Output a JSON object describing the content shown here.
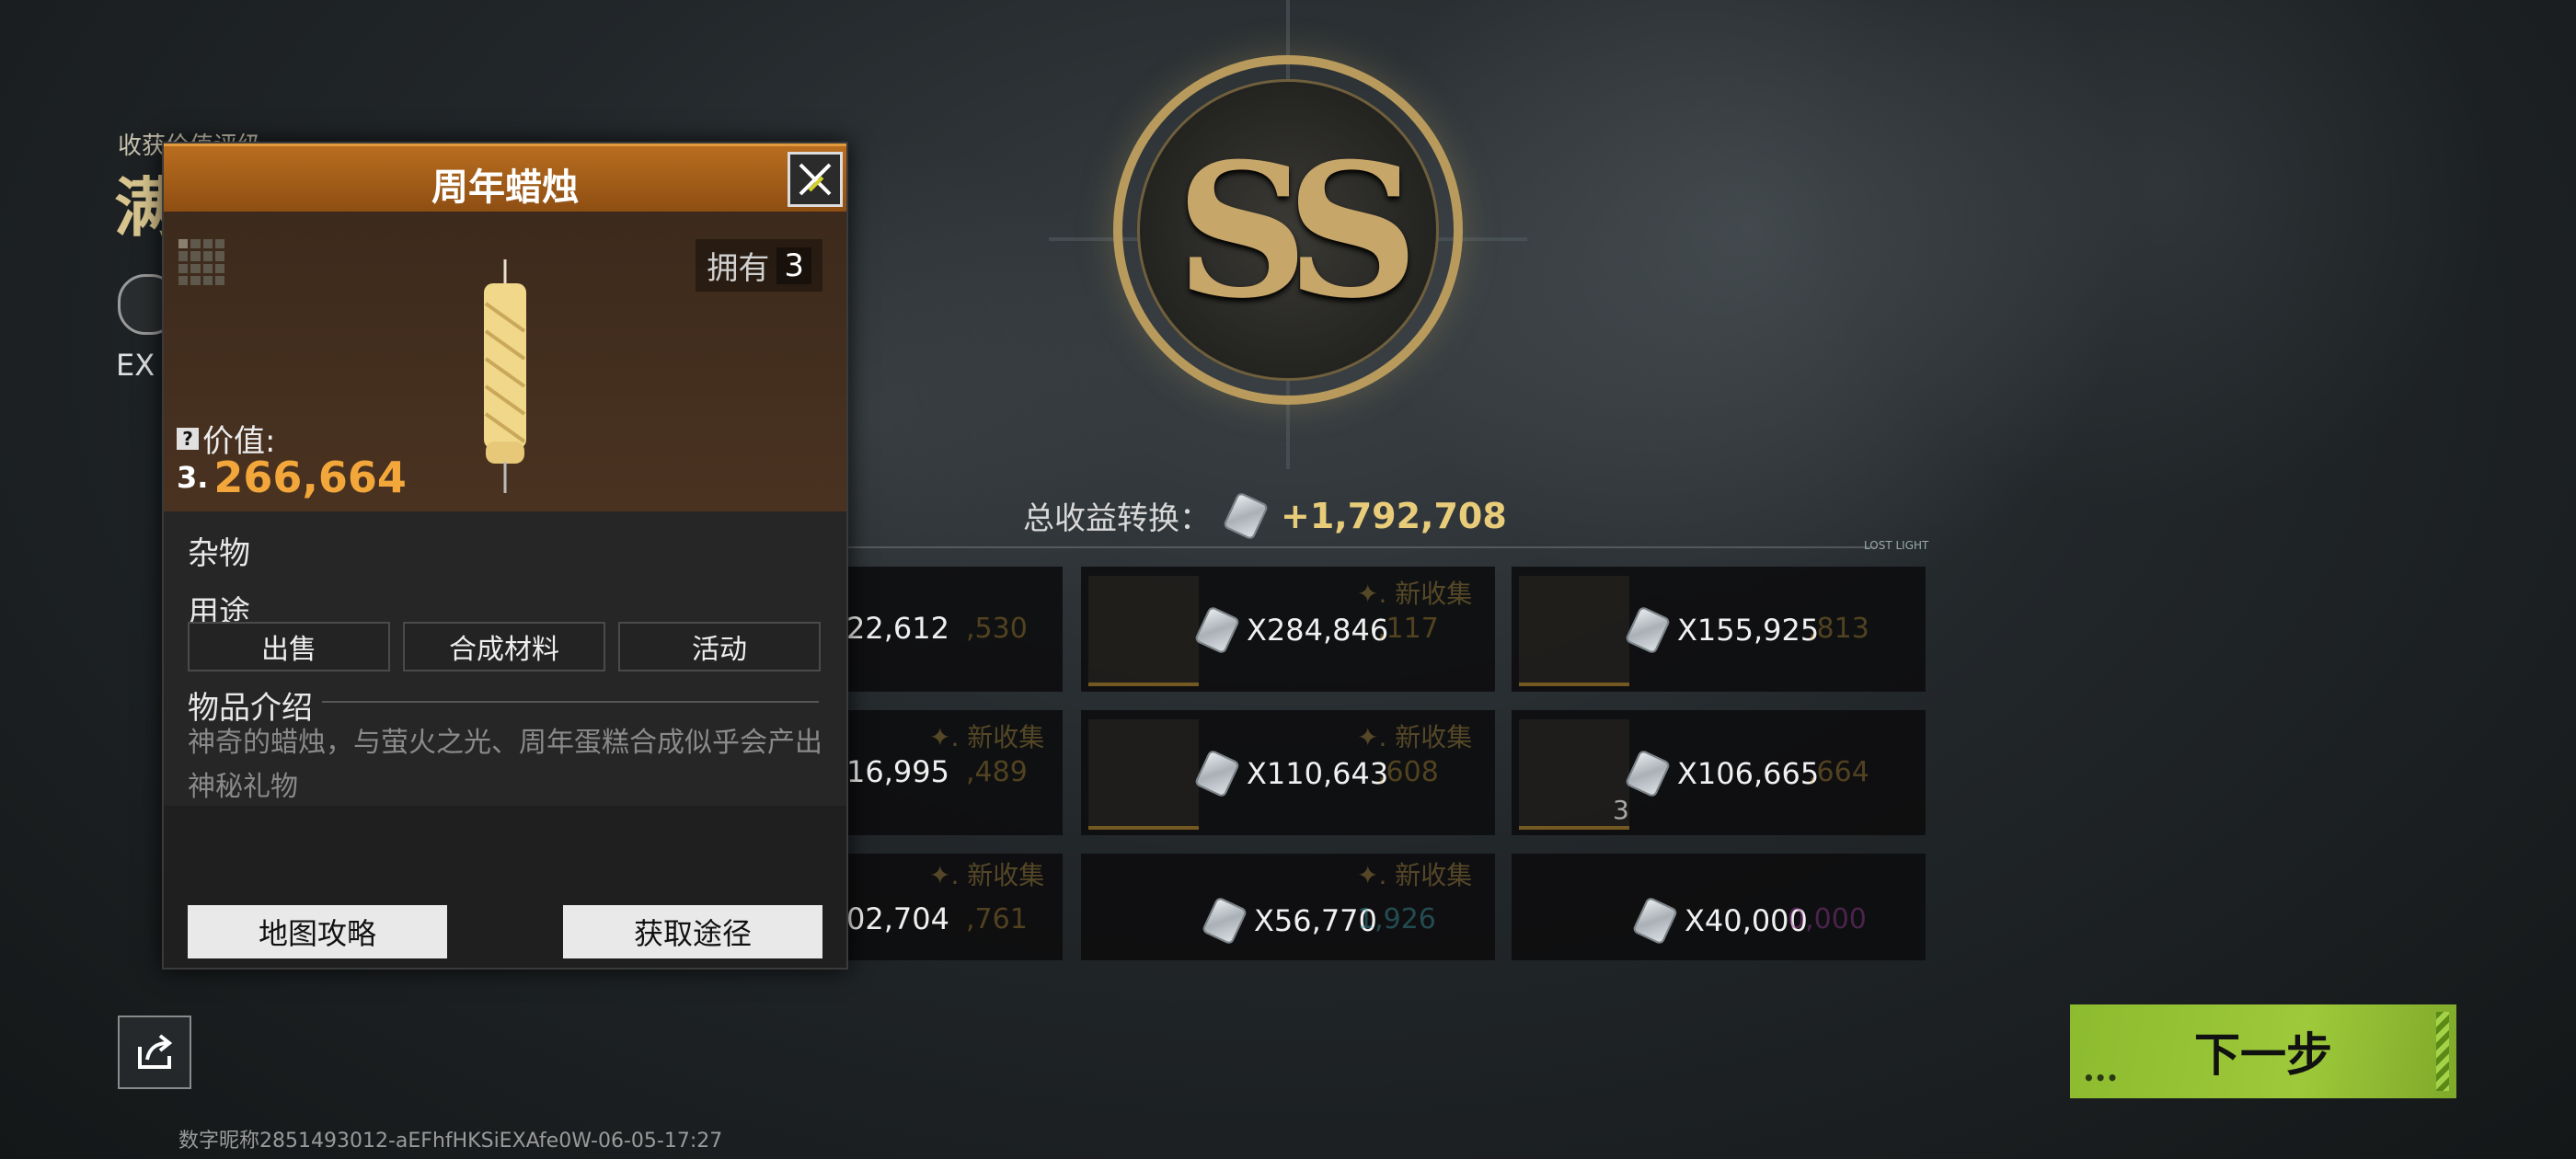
{
  "colors": {
    "accent": "#f3a73a",
    "header": "#b96d1f",
    "next_button": "#9dc93a",
    "gold": "#c7a66a"
  },
  "background": {
    "rating_label": "收获价值评级",
    "rating_value": "满",
    "exp_label": "EX"
  },
  "emblem": {
    "grade": "SS"
  },
  "summary": {
    "total_label": "总收益转换：",
    "total_value": "+1,792,708",
    "divider_tag": "LOST LIGHT"
  },
  "grid": {
    "new_label": "✦. 新收集",
    "cards": [
      {
        "value": "22,612",
        "ghost": ",530"
      },
      {
        "value": "X284,846",
        "ghost": ",117",
        "new": true
      },
      {
        "value": "X155,925",
        "ghost": ",813"
      },
      {
        "value": "16,995",
        "ghost": ",489",
        "new": true
      },
      {
        "value": "X110,643",
        "ghost": ",608",
        "new": true
      },
      {
        "value": "X106,665",
        "ghost": ",664",
        "badge": "3"
      },
      {
        "value": "02,704",
        "ghost": ",761",
        "new": true
      },
      {
        "value": "X56,770",
        "ghost": "1,926",
        "new": true
      },
      {
        "value": "X40,000",
        "ghost": "0,000"
      }
    ]
  },
  "popup": {
    "title": "周年蜡烛",
    "own_label": "拥有",
    "own_count": "3",
    "value_label": "价值:",
    "value_icon": "3.",
    "value": "266,664",
    "type": "杂物",
    "usage_label": "用途",
    "usage": [
      "出售",
      "合成材料",
      "活动"
    ],
    "desc_title": "物品介绍",
    "desc": "神奇的蜡烛，与萤火之光、周年蛋糕合成似乎会产出神秘礼物",
    "btn_map": "地图攻略",
    "btn_source": "获取途径"
  },
  "footer": {
    "player_id": "数字昵称2851493012-aEFhfHKSiEXAfe0W-06-05-17:27"
  },
  "next": {
    "label": "下一步",
    "dots": "•••"
  }
}
